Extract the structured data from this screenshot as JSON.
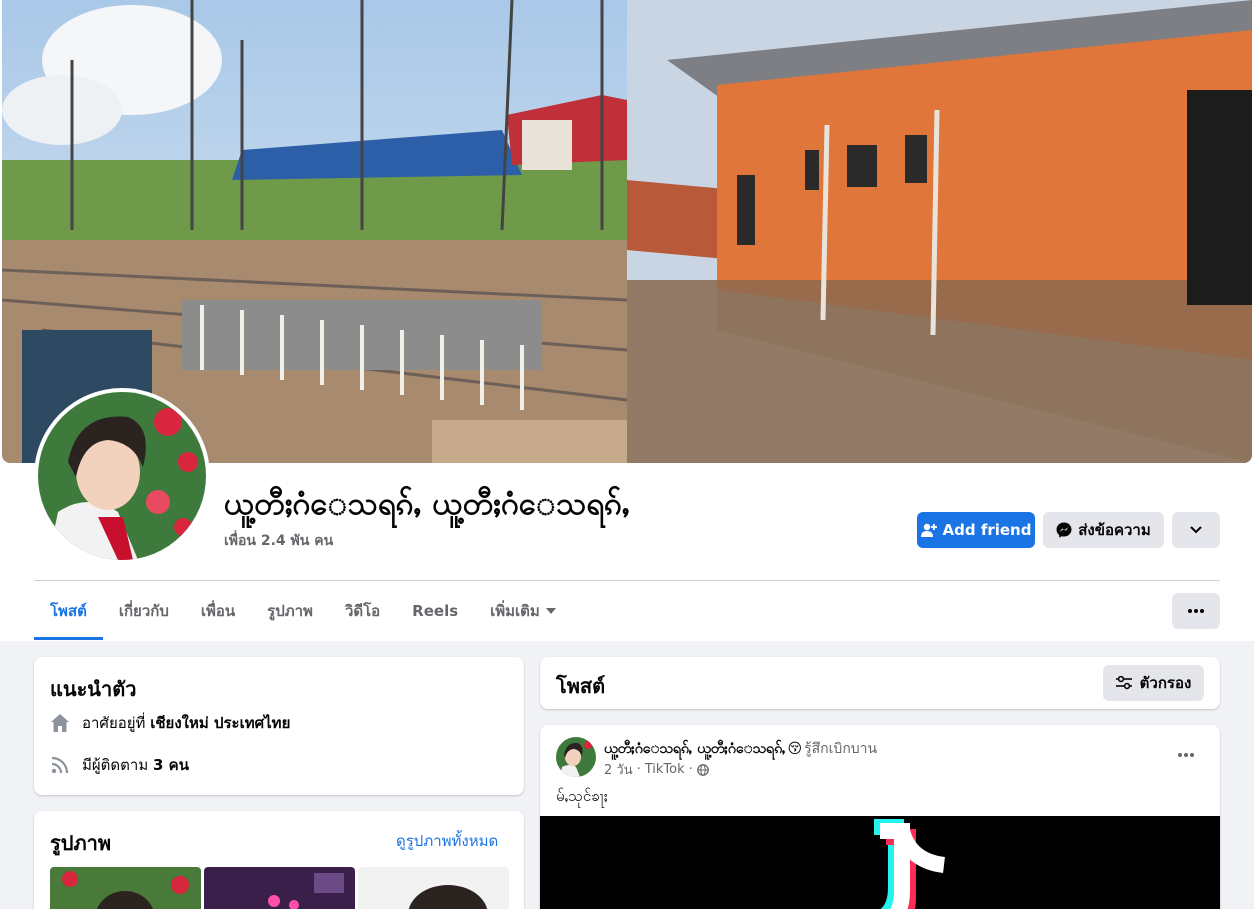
{
  "profile": {
    "name": "ယူ့တီႈဂံေသရၵ်ႇ ယူ့တီႈဂံေသရၵ်ႇ",
    "friends": "เพื่อน 2.4 พัน คน"
  },
  "actions": {
    "add_friend": "Add friend",
    "message": "ส่งข้อความ"
  },
  "tabs": [
    {
      "label": "โพสต์",
      "active": true
    },
    {
      "label": "เกี่ยวกับ"
    },
    {
      "label": "เพื่อน"
    },
    {
      "label": "รูปภาพ"
    },
    {
      "label": "วิดีโอ"
    },
    {
      "label": "Reels"
    },
    {
      "label": "เพิ่มเติม"
    }
  ],
  "intro": {
    "title": "แนะนำตัว",
    "lives_prefix": "อาศัยอยู่ที่",
    "lives_place": "เชียงใหม่ ประเทศไทย",
    "followers_prefix": "มีผู้ติดตาม",
    "followers_count": "3 คน"
  },
  "photos": {
    "title": "รูปภาพ",
    "see_all": "ดูรูปภาพทั้งหมด"
  },
  "posts": {
    "title": "โพสต์",
    "filter": "ตัวกรอง"
  },
  "post": {
    "author": "ယူ့တီႈဂံေသရၵ်ႇ ယူ့တီႈဂံေသရၵ်ႇ",
    "emoji": "😚",
    "feeling": "รู้สึกเบิกบาน",
    "time": "2 วัน",
    "source": "TikTok",
    "text": "မ်ႇသုင်ၶႃႈ"
  },
  "colors": {
    "accent": "#1b74e4",
    "secondary_text": "#65676b",
    "button_gray": "#e4e6eb",
    "page_bg": "#f0f2f5"
  },
  "icons": {
    "add_friend": "person-plus-icon",
    "message": "messenger-icon",
    "more": "chevron-down-icon",
    "home": "house-icon",
    "followers": "rss-icon",
    "filter": "sliders-icon",
    "globe": "globe-icon"
  }
}
